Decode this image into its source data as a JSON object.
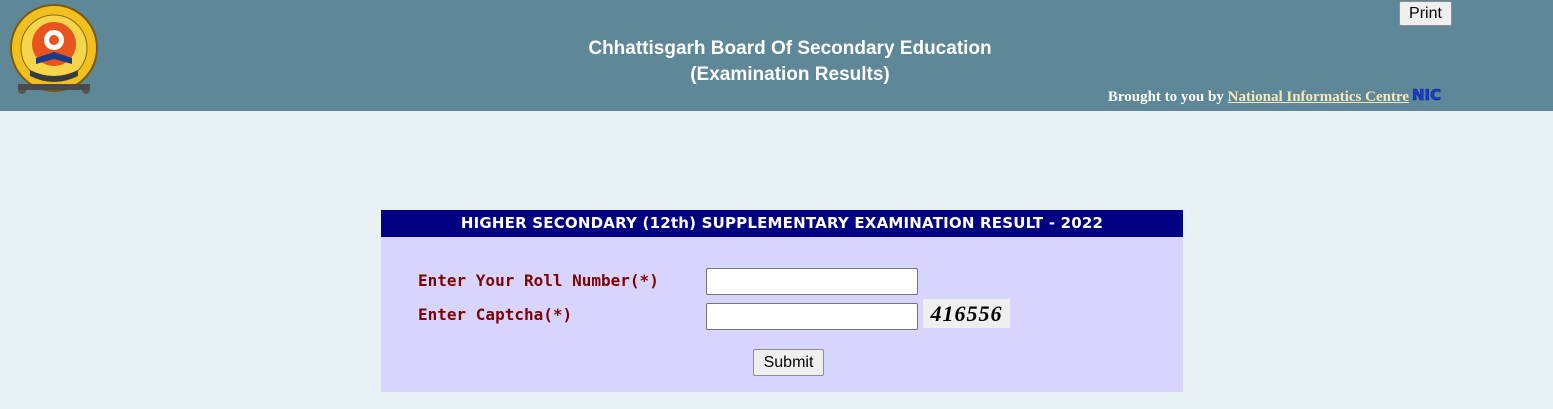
{
  "header": {
    "title_line1": "Chhattisgarh Board Of Secondary Education",
    "title_line2": "(Examination Results)",
    "print_label": "Print",
    "credit_prefix": "Brought to you by ",
    "credit_link": "National Informatics Centre",
    "logo_icon": "cgbse-emblem-icon",
    "nic_icon": "nic-logo-icon",
    "nic_text": "NIC"
  },
  "form": {
    "title": "HIGHER SECONDARY (12th) SUPPLEMENTARY EXAMINATION RESULT - 2022",
    "roll_label": "Enter Your Roll Number(*)",
    "roll_value": "",
    "captcha_label": "Enter Captcha(*)",
    "captcha_value": "",
    "captcha_code": "416556",
    "submit_label": "Submit"
  },
  "colors": {
    "header_bg": "#5e8797",
    "page_bg": "#e8f1f5",
    "panel_title_bg": "#000080",
    "panel_body_bg": "#d7d5fe",
    "label_color": "#800000",
    "link_color": "#f6e9b5"
  }
}
